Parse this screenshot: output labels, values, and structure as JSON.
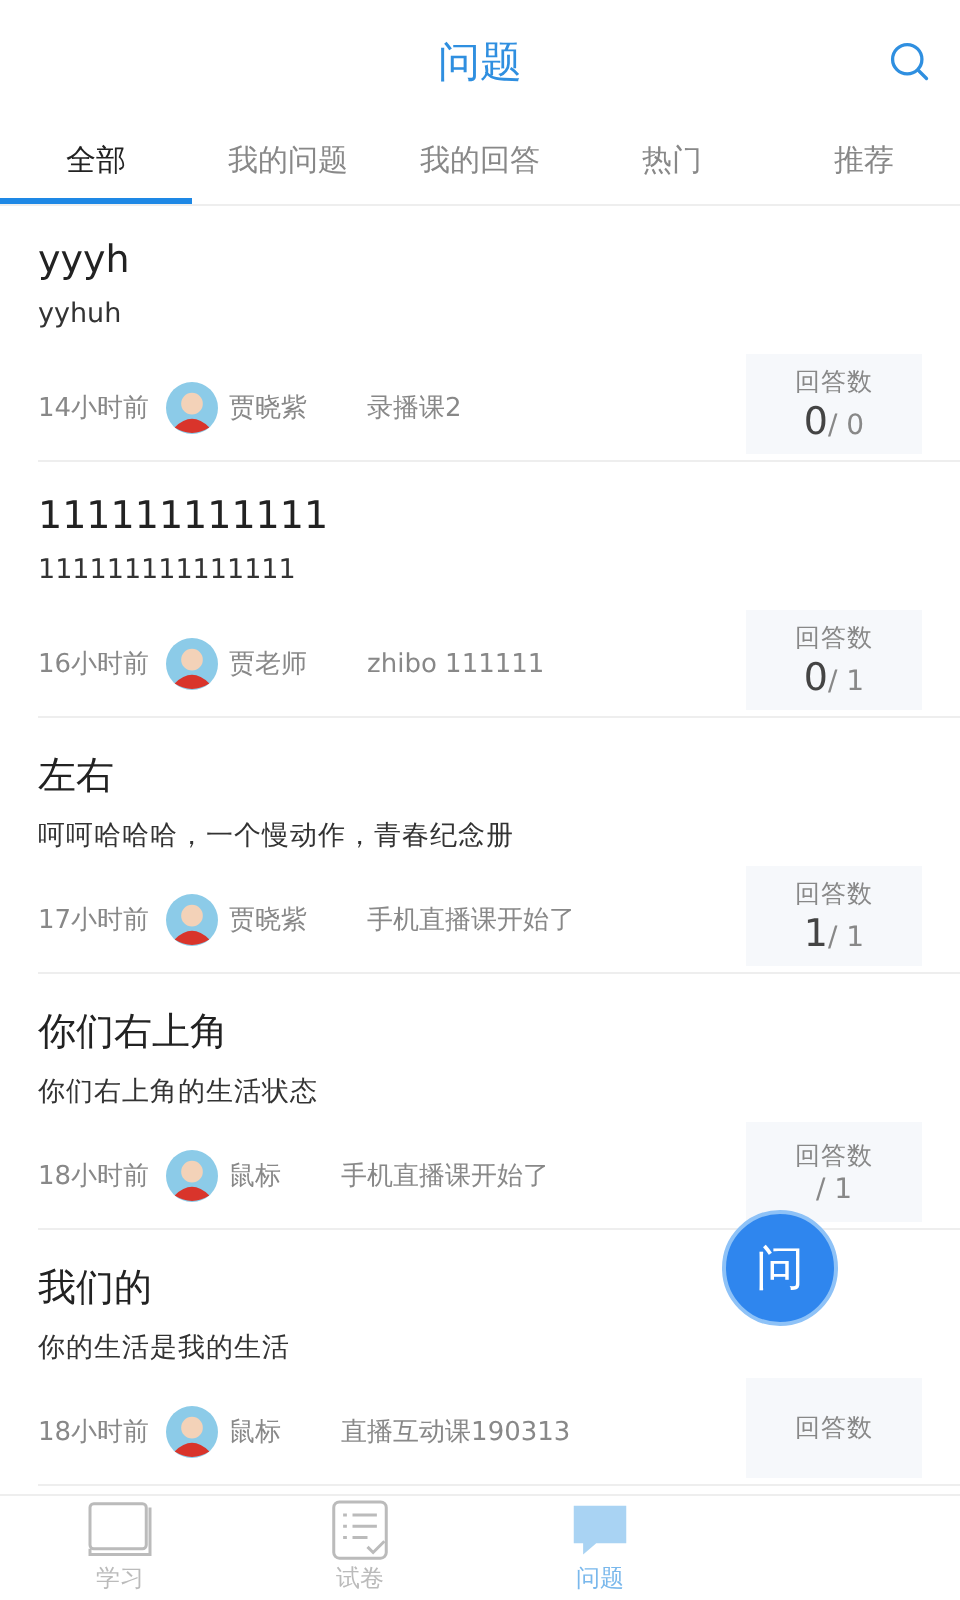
{
  "header": {
    "title": "问题"
  },
  "tabs": [
    {
      "label": "全部",
      "selected": true
    },
    {
      "label": "我的问题",
      "selected": false
    },
    {
      "label": "我的回答",
      "selected": false
    },
    {
      "label": "热门",
      "selected": false
    },
    {
      "label": "推荐",
      "selected": false
    }
  ],
  "questions": [
    {
      "title": "yyyh",
      "body": "yyhuh",
      "time": "14小时前",
      "author": "贾晓紫",
      "course": "录播课2",
      "answers_label": "回答数",
      "answered": "0",
      "total": "/ 0"
    },
    {
      "title": "111111111111",
      "body": "111111111111111",
      "time": "16小时前",
      "author": "贾老师",
      "course": "zhibo 111111",
      "answers_label": "回答数",
      "answered": "0",
      "total": "/ 1"
    },
    {
      "title": "左右",
      "body": "呵呵哈哈哈，一个慢动作，青春纪念册",
      "time": "17小时前",
      "author": "贾晓紫",
      "course": "手机直播课开始了",
      "answers_label": "回答数",
      "answered": "1",
      "total": "/ 1"
    },
    {
      "title": "你们右上角",
      "body": "你们右上角的生活状态",
      "time": "18小时前",
      "author": "鼠标",
      "course": "手机直播课开始了",
      "answers_label": "回答数",
      "total": "/ 1"
    },
    {
      "title": "我们的",
      "body": "你的生活是我的生活",
      "time": "18小时前",
      "author": "鼠标",
      "course": "直播互动课190313",
      "answers_label": "回答数"
    }
  ],
  "ask_button": {
    "label": "问"
  },
  "bottom_nav": [
    {
      "label": "学习",
      "kind": "book",
      "selected": false
    },
    {
      "label": "试卷",
      "kind": "paper",
      "selected": false
    },
    {
      "label": "问题",
      "kind": "question",
      "selected": true
    }
  ]
}
